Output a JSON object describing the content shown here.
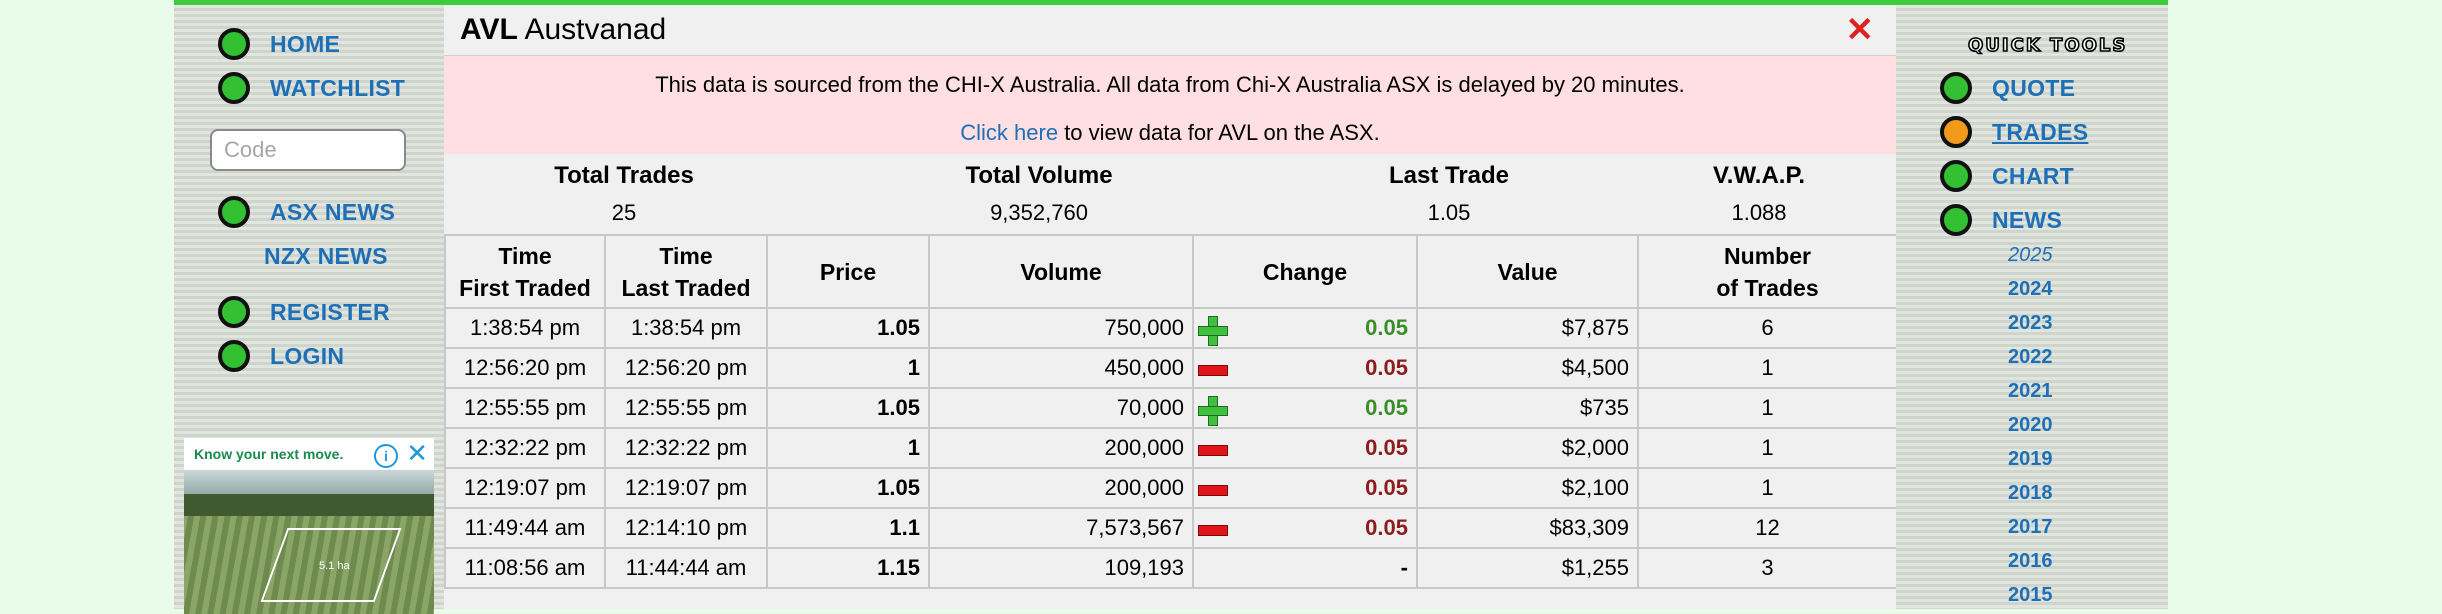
{
  "left_nav": {
    "items": [
      {
        "label": "HOME"
      },
      {
        "label": "WATCHLIST"
      },
      {
        "label": "ASX NEWS"
      },
      {
        "label": "NZX NEWS"
      },
      {
        "label": "REGISTER"
      },
      {
        "label": "LOGIN"
      }
    ],
    "code_placeholder": "Code"
  },
  "ad": {
    "tagline": "Know your next move.",
    "info_icon": "info-icon",
    "close_icon": "close-icon",
    "plot_label": "5.1 ha"
  },
  "header": {
    "code": "AVL",
    "name": "Austvanad",
    "close_symbol": "✕"
  },
  "notice": {
    "line1": "This data is sourced from the CHI-X Australia. All data from Chi-X Australia ASX is delayed by 20 minutes.",
    "link_text": "Click here",
    "line2_rest": " to view data for AVL on the ASX."
  },
  "summary": {
    "total_trades_label": "Total Trades",
    "total_trades": "25",
    "total_volume_label": "Total Volume",
    "total_volume": "9,352,760",
    "last_trade_label": "Last Trade",
    "last_trade": "1.05",
    "vwap_label": "V.W.A.P.",
    "vwap": "1.088"
  },
  "table": {
    "headers": {
      "first_l1": "Time",
      "first_l2": "First Traded",
      "last_l1": "Time",
      "last_l2": "Last Traded",
      "price": "Price",
      "volume": "Volume",
      "change": "Change",
      "value": "Value",
      "num_l1": "Number",
      "num_l2": "of Trades"
    },
    "rows": [
      {
        "first": "1:38:54 pm",
        "last": "1:38:54 pm",
        "price": "1.05",
        "volume": "750,000",
        "dir": "up",
        "change": "0.05",
        "value": "$7,875",
        "trades": "6"
      },
      {
        "first": "12:56:20 pm",
        "last": "12:56:20 pm",
        "price": "1",
        "volume": "450,000",
        "dir": "down",
        "change": "0.05",
        "value": "$4,500",
        "trades": "1"
      },
      {
        "first": "12:55:55 pm",
        "last": "12:55:55 pm",
        "price": "1.05",
        "volume": "70,000",
        "dir": "up",
        "change": "0.05",
        "value": "$735",
        "trades": "1"
      },
      {
        "first": "12:32:22 pm",
        "last": "12:32:22 pm",
        "price": "1",
        "volume": "200,000",
        "dir": "down",
        "change": "0.05",
        "value": "$2,000",
        "trades": "1"
      },
      {
        "first": "12:19:07 pm",
        "last": "12:19:07 pm",
        "price": "1.05",
        "volume": "200,000",
        "dir": "down",
        "change": "0.05",
        "value": "$2,100",
        "trades": "1"
      },
      {
        "first": "11:49:44 am",
        "last": "12:14:10 pm",
        "price": "1.1",
        "volume": "7,573,567",
        "dir": "down",
        "change": "0.05",
        "value": "$83,309",
        "trades": "12"
      },
      {
        "first": "11:08:56 am",
        "last": "11:44:44 am",
        "price": "1.15",
        "volume": "109,193",
        "dir": "none",
        "change": "-",
        "value": "$1,255",
        "trades": "3"
      }
    ]
  },
  "right_nav": {
    "title": "QUICK TOOLS",
    "items": [
      {
        "label": "QUOTE",
        "active": false
      },
      {
        "label": "TRADES",
        "active": true
      },
      {
        "label": "CHART",
        "active": false
      },
      {
        "label": "NEWS",
        "active": false
      }
    ],
    "years": [
      "2025",
      "2024",
      "2023",
      "2022",
      "2021",
      "2020",
      "2019",
      "2018",
      "2017",
      "2016",
      "2015"
    ]
  },
  "colors": {
    "accent_green": "#3ccd3c",
    "link_blue": "#1e6fb5",
    "up_green": "#3a8e2a",
    "down_red": "#8e1c1c",
    "notice_pink": "#ffdfe1",
    "active_orange": "#f39a1b"
  }
}
